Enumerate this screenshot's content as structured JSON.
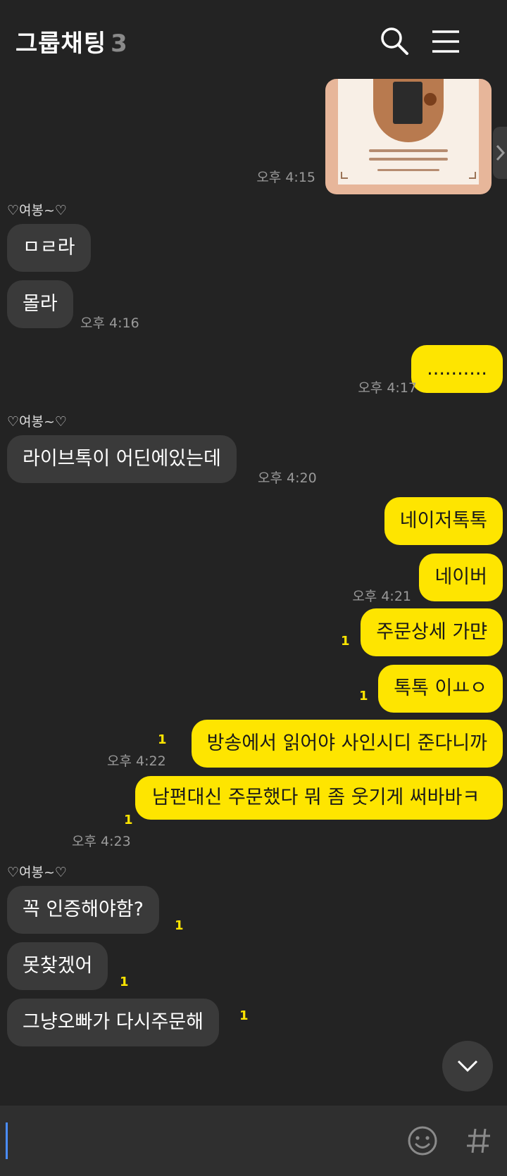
{
  "header": {
    "title": "그룹채팅",
    "member_count": "3",
    "search_icon": "search-icon",
    "menu_icon": "hamburger-menu-icon"
  },
  "messages": [
    {
      "type": "image",
      "side": "sent",
      "time": "오후 4:15"
    },
    {
      "sender": "♡여봉~♡"
    },
    {
      "side": "recv",
      "text": "ㅁㄹ라"
    },
    {
      "side": "recv",
      "text": "몰라",
      "time": "오후 4:16"
    },
    {
      "side": "sent",
      "text": "..........",
      "time": "오후 4:17"
    },
    {
      "sender": "♡여봉~♡"
    },
    {
      "side": "recv",
      "text": "라이브톡이 어딘에있는데",
      "time": "오후 4:20"
    },
    {
      "side": "sent",
      "text": "네이저톡톡"
    },
    {
      "side": "sent",
      "text": "네이버",
      "time": "오후 4:21"
    },
    {
      "side": "sent",
      "text": "주문상세 가먄",
      "unread": "1"
    },
    {
      "side": "sent",
      "text": "톡톡 이ㅛㅇ",
      "unread": "1"
    },
    {
      "side": "sent",
      "text": "방송에서 읽어야 사인시디 준다니까",
      "unread": "1",
      "time": "오후 4:22"
    },
    {
      "side": "sent",
      "text": "남편대신 주문했다 뭐 좀 웃기게 써바바ㅋ",
      "unread": "1",
      "time": "오후 4:23"
    },
    {
      "sender": "♡여봉~♡"
    },
    {
      "side": "recv",
      "text": "꼭 인증해야함?",
      "unread": "1"
    },
    {
      "side": "recv",
      "text": "못찾겠어",
      "unread": "1"
    },
    {
      "side": "recv",
      "text": "그냥오빠가 다시주문해",
      "unread": "1"
    }
  ],
  "input": {
    "placeholder": ""
  },
  "colors": {
    "background": "#232323",
    "sent_bubble": "#fee500",
    "recv_bubble": "#3a3a3a",
    "unread": "#fee500"
  }
}
